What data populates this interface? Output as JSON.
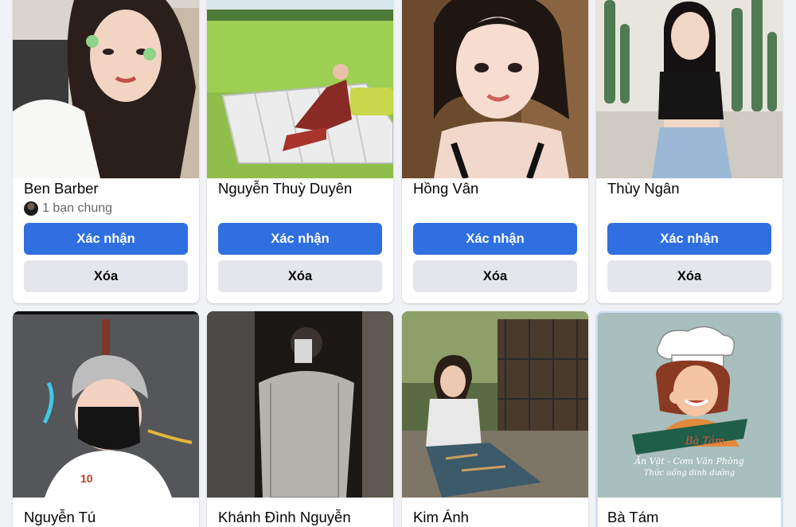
{
  "requests": [
    {
      "name": "Ben Barber",
      "mutual_friends": "1 bạn chung",
      "confirm_label": "Xác nhận",
      "delete_label": "Xóa"
    },
    {
      "name": "Nguyễn Thuỳ Duyên",
      "confirm_label": "Xác nhận",
      "delete_label": "Xóa"
    },
    {
      "name": "Hồng Vân",
      "confirm_label": "Xác nhận",
      "delete_label": "Xóa"
    },
    {
      "name": "Thùy Ngân",
      "confirm_label": "Xác nhận",
      "delete_label": "Xóa"
    },
    {
      "name": "Nguyễn Tú"
    },
    {
      "name": "Khánh Đình Nguyễn"
    },
    {
      "name": "Kim Ánh"
    },
    {
      "name": "Bà Tám",
      "logo_text": {
        "brand": "Bà Tám",
        "line1": "Ăn Vặt - Cơm Văn Phòng",
        "line2": "Thức uống dinh dưỡng"
      }
    }
  ],
  "colors": {
    "primary": "#2f6fdf",
    "secondary": "#e4e6eb",
    "background": "#f0f2f5",
    "text": "#050505",
    "muted": "#65676b"
  }
}
